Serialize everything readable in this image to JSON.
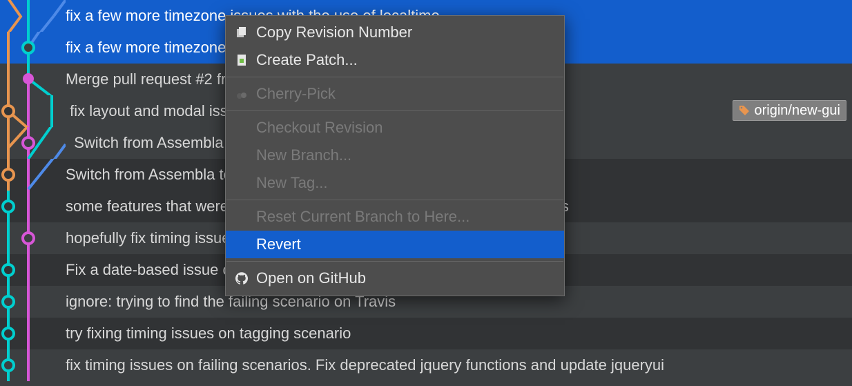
{
  "commits": [
    {
      "message": "fix a few more timezone issues with the use of localtime",
      "alt": false,
      "selected": true
    },
    {
      "message": "fix a few more timezone issues with the use of localtime",
      "alt": false,
      "selected": true
    },
    {
      "message": "Merge pull request #2 from slashrsm/recurring-todo",
      "alt": false,
      "selected": false
    },
    {
      "message": " fix layout and modal issues",
      "alt": false,
      "selected": false,
      "tag": "origin/new-gui",
      "tag_color": "#e8954f"
    },
    {
      "message": "  Switch from Assembla to GitHub issues",
      "alt": false,
      "selected": false
    },
    {
      "message": "Switch from Assembla to GitHub issues",
      "alt": true,
      "selected": false
    },
    {
      "message": "some features that were wip-ed because of cucumber issues seem to pass",
      "alt": true,
      "selected": false
    },
    {
      "message": "hopefully fix timing issue in drag-and-drop cucumber step",
      "alt": false,
      "selected": false
    },
    {
      "message": "Fix a date-based issue on the test suite",
      "alt": true,
      "selected": false
    },
    {
      "message": "ignore: trying to find the failing scenario on Travis",
      "alt": false,
      "selected": false
    },
    {
      "message": "try fixing timing issues on tagging scenario",
      "alt": true,
      "selected": false
    },
    {
      "message": "fix timing issues on failing scenarios. Fix deprecated jquery functions and update jqueryui",
      "alt": false,
      "selected": false
    }
  ],
  "context_menu": {
    "items": [
      {
        "label": "Copy Revision Number",
        "enabled": true,
        "icon": "copy-icon"
      },
      {
        "label": "Create Patch...",
        "enabled": true,
        "icon": "patch-icon"
      },
      {
        "sep": true
      },
      {
        "label": "Cherry-Pick",
        "enabled": false,
        "icon": "cherries-icon"
      },
      {
        "sep": true
      },
      {
        "label": "Checkout Revision",
        "enabled": false
      },
      {
        "label": "New Branch...",
        "enabled": false
      },
      {
        "label": "New Tag...",
        "enabled": false
      },
      {
        "sep": true
      },
      {
        "label": "Reset Current Branch to Here...",
        "enabled": false
      },
      {
        "label": "Revert",
        "enabled": true,
        "hover": true
      },
      {
        "sep": true
      },
      {
        "label": "Open on GitHub",
        "enabled": true,
        "icon": "github-icon"
      }
    ]
  }
}
